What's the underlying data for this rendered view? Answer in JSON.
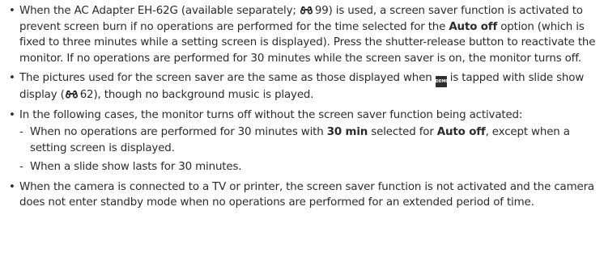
{
  "bullets": {
    "b1": {
      "t1": "When the AC Adapter EH-62G (available separately; ",
      "ref1": "99",
      "t2": ") is used, a screen saver function is activated to prevent screen burn if no operations are performed for the time selected for the ",
      "bold1": "Auto off",
      "t3": " option (which is fixed to three minutes while a setting screen is displayed). Press the shutter-release button to reactivate the monitor. If no operations are performed for 30 minutes while the screen saver is on, the monitor turns off."
    },
    "b2": {
      "t1": "The pictures used for the screen saver are the same as those displayed when ",
      "demo_icon_label": "DEMO",
      "t2": " is tapped with slide show display (",
      "ref1": "62",
      "t3": "), though no background music is played."
    },
    "b3": {
      "t1": "In the following cases, the monitor turns off without the screen saver function being activated:",
      "sub": {
        "s1": {
          "t1": "When no operations are performed for 30 minutes with ",
          "bold1": "30 min",
          "t2": " selected for ",
          "bold2": "Auto off",
          "t3": ", except when a setting screen is displayed."
        },
        "s2": {
          "t1": "When a slide show lasts for 30 minutes."
        }
      }
    },
    "b4": {
      "t1": "When the camera is connected to a TV or printer, the screen saver function is not activated and the camera does not enter standby mode when no operations are performed for an extended period of time."
    }
  },
  "glyphs": {
    "bullet": "•",
    "dash": "-"
  },
  "icons": {
    "reference": "binoculars-icon",
    "demo": "demo-slideshow-icon"
  }
}
